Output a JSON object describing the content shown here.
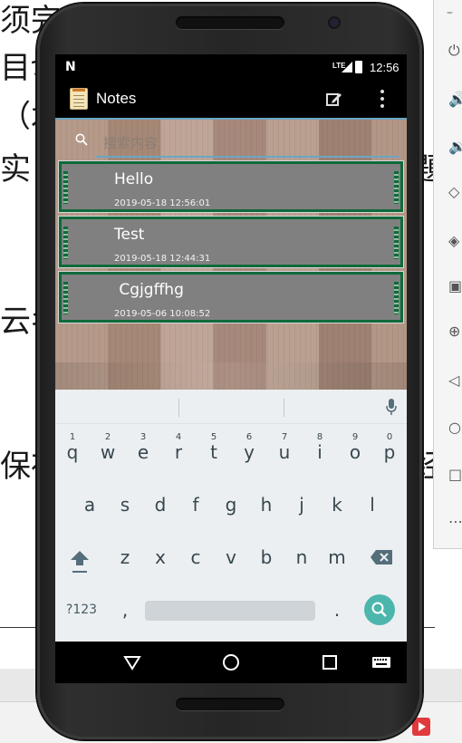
{
  "background_doc": {
    "fragments": [
      "须完成",
      "目切",
      "（木",
      "实",
      "云名",
      "保存",
      "題",
      "经"
    ]
  },
  "status_bar": {
    "network": "LTE",
    "time": "12:56"
  },
  "action_bar": {
    "title": "Notes",
    "compose_icon": "compose-icon",
    "overflow_icon": "overflow-menu-icon"
  },
  "search": {
    "placeholder": "搜索内容",
    "value": ""
  },
  "notes": [
    {
      "title": "Hello",
      "date": "2019-05-18 12:56:01"
    },
    {
      "title": "Test",
      "date": "2019-05-18 12:44:31"
    },
    {
      "title": " Cgjgffhg",
      "date": "2019-05-06 10:08:52"
    }
  ],
  "keyboard": {
    "row1": [
      {
        "key": "q",
        "hint": "1"
      },
      {
        "key": "w",
        "hint": "2"
      },
      {
        "key": "e",
        "hint": "3"
      },
      {
        "key": "r",
        "hint": "4"
      },
      {
        "key": "t",
        "hint": "5"
      },
      {
        "key": "y",
        "hint": "6"
      },
      {
        "key": "u",
        "hint": "7"
      },
      {
        "key": "i",
        "hint": "8"
      },
      {
        "key": "o",
        "hint": "9"
      },
      {
        "key": "p",
        "hint": "0"
      }
    ],
    "row2": [
      "a",
      "s",
      "d",
      "f",
      "g",
      "h",
      "j",
      "k",
      "l"
    ],
    "row3": [
      "z",
      "x",
      "c",
      "v",
      "b",
      "n",
      "m"
    ],
    "symbols_label": "?123",
    "comma": ",",
    "period": ".",
    "accent_color": "#4db6ac"
  },
  "nav": {
    "back_icon": "back-triangle-icon",
    "home_icon": "home-circle-icon",
    "recents_icon": "recents-square-icon",
    "keyboard_icon": "keyboard-icon"
  }
}
